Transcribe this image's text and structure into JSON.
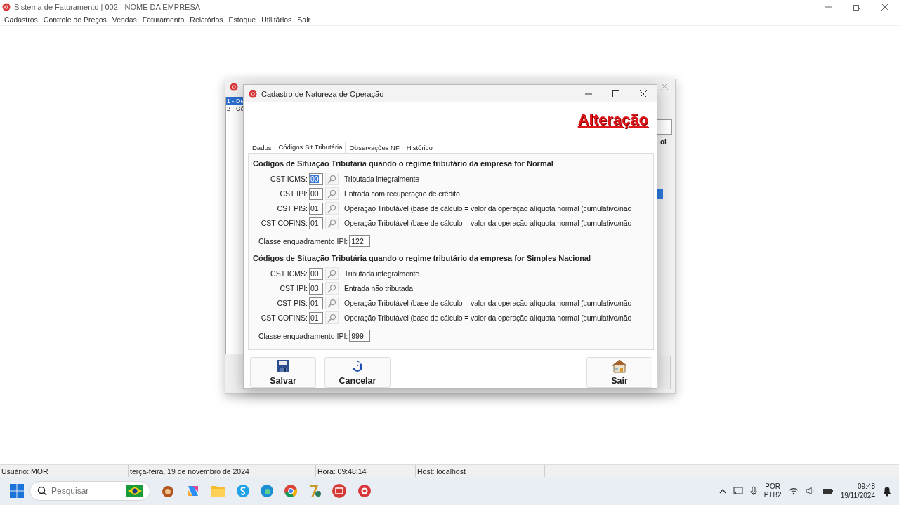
{
  "app_window": {
    "title": "Sistema de Faturamento | 002 - NOME DA EMPRESA",
    "menu": [
      "Cadastros",
      "Controle de Preços",
      "Vendas",
      "Faturamento",
      "Relatórios",
      "Estoque",
      "Utilitários",
      "Sair"
    ]
  },
  "back_window": {
    "list_items": [
      {
        "label": "1 - De",
        "selected": true
      },
      {
        "label": "2 - Có",
        "selected": false
      }
    ],
    "column_header": "ol"
  },
  "dialog": {
    "title": "Cadastro de Natureza de Operação",
    "mode": "Alteração",
    "tabs": [
      {
        "label": "Dados",
        "selected": false
      },
      {
        "label": "Códigos Sit.Tributária",
        "selected": true
      },
      {
        "label": "Observações NF",
        "selected": false
      },
      {
        "label": "Histórico",
        "selected": false
      }
    ],
    "sections": [
      {
        "heading": "Códigos de Situação Tributária quando o regime tributário da empresa for Normal",
        "rows": [
          {
            "label": "CST ICMS:",
            "code": "00",
            "selected": true,
            "description": "Tributada integralmente"
          },
          {
            "label": "CST IPI:",
            "code": "00",
            "selected": false,
            "description": "Entrada com recuperação de crédito"
          },
          {
            "label": "CST PIS:",
            "code": "01",
            "selected": false,
            "description": "Operação Tributável (base de cálculo = valor da operação alíquota normal (cumulativo/não"
          },
          {
            "label": "CST COFINS:",
            "code": "01",
            "selected": false,
            "description": "Operação Tributável (base de cálculo = valor da operação alíquota normal (cumulativo/não"
          }
        ],
        "class_label": "Classe enquadramento IPI:",
        "class_value": "122"
      },
      {
        "heading": "Códigos de Situação Tributária quando o regime tributário da empresa for Simples Nacional",
        "rows": [
          {
            "label": "CST ICMS:",
            "code": "00",
            "selected": false,
            "description": "Tributada integralmente"
          },
          {
            "label": "CST IPI:",
            "code": "03",
            "selected": false,
            "description": "Entrada não tributada"
          },
          {
            "label": "CST PIS:",
            "code": "01",
            "selected": false,
            "description": "Operação Tributável (base de cálculo = valor da operação alíquota normal (cumulativo/não"
          },
          {
            "label": "CST COFINS:",
            "code": "01",
            "selected": false,
            "description": "Operação Tributável (base de cálculo = valor da operação alíquota normal (cumulativo/não"
          }
        ],
        "class_label": "Classe enquadramento IPI:",
        "class_value": "999"
      }
    ],
    "buttons": [
      {
        "label": "Salvar",
        "kind": "save"
      },
      {
        "label": "Cancelar",
        "kind": "cancel"
      },
      {
        "label": "Sair",
        "kind": "exit"
      }
    ]
  },
  "status_bar": [
    "Usuário: MOR",
    "terça-feira, 19 de novembro de 2024",
    "Hora: 09:48:14",
    "Host: localhost"
  ],
  "taskbar": {
    "search_placeholder": "Pesquisar",
    "language": "POR",
    "layout": "PTB2",
    "time": "09:48",
    "date": "19/11/2024"
  }
}
